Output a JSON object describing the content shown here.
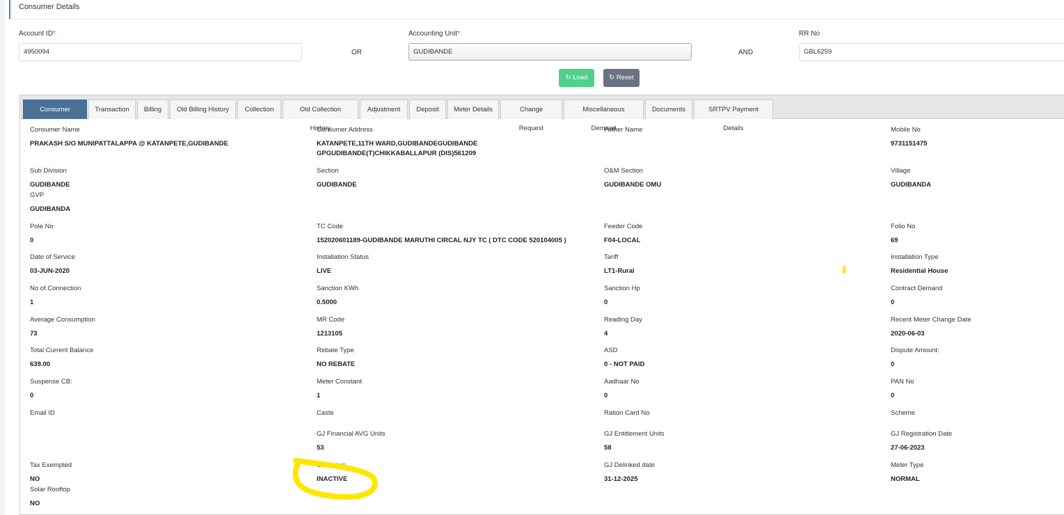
{
  "header": {
    "title": "Consumer Details"
  },
  "search": {
    "account_id_label": "Account ID",
    "account_id_value": "4950094",
    "or_label": "OR",
    "accounting_unit_label": "Accounting Unit",
    "accounting_unit_value": "GUDIBANDE",
    "and_label": "AND",
    "rr_no_label": "RR No",
    "rr_no_value": "GBL6259",
    "required_mark": "*",
    "load_label": "Load",
    "reset_label": "Reset"
  },
  "colors": {
    "load": "#4fd18b",
    "reset": "#6c7283",
    "active_tab": "#4a7094",
    "highlight": "#ffe600"
  },
  "tabs": [
    "Consumer Details",
    "Transaction",
    "Billing",
    "Old Billing History",
    "Collection",
    "Old Collection History",
    "Adjustment",
    "Deposit",
    "Meter Details",
    "Change Request",
    "Miscellaneous Demand",
    "Documents",
    "SRTPV Payment Details"
  ],
  "fields": [
    {
      "label": "Consumer Name",
      "value": "PRAKASH S/O MUNIPATTALAPPA @ KATANPETE,GUDIBANDE",
      "row": 0,
      "col": 0
    },
    {
      "label": "Consumer Address",
      "value": "KATANPETE,11TH WARD,GUDIBANDEGUDIBANDE GPGUDIBANDE(T)CHIKKABALLAPUR (DIS)561209",
      "row": 0,
      "col": 1
    },
    {
      "label": "Father Name",
      "value": "",
      "row": 0,
      "col": 2
    },
    {
      "label": "Mobile No",
      "value": "9731151475",
      "row": 0,
      "col": 3
    },
    {
      "label": "Sub Division",
      "value": "GUDIBANDE",
      "row": 1,
      "col": 0
    },
    {
      "label": "Section",
      "value": "GUDIBANDE",
      "row": 1,
      "col": 1
    },
    {
      "label": "O&M Section",
      "value": "GUDIBANDE OMU",
      "row": 1,
      "col": 2
    },
    {
      "label": "Village",
      "value": "GUDIBANDA",
      "row": 1,
      "col": 3
    },
    {
      "label": "GVP",
      "value": "GUDIBANDA",
      "row": 2,
      "col": 0
    },
    {
      "label": "Pole No",
      "value": "0",
      "row": 3,
      "col": 0
    },
    {
      "label": "TC Code",
      "value": "152020601189-GUDIBANDE MARUTHI CIRCAL NJY TC ( DTC CODE 520104005 )",
      "row": 3,
      "col": 1
    },
    {
      "label": "Feeder Code",
      "value": "F04-LOCAL",
      "row": 3,
      "col": 2
    },
    {
      "label": "Folio No",
      "value": "69",
      "row": 3,
      "col": 3
    },
    {
      "label": "Date of Service",
      "value": "03-JUN-2020",
      "row": 4,
      "col": 0
    },
    {
      "label": "Installation Status",
      "value": "LIVE",
      "row": 4,
      "col": 1
    },
    {
      "label": "Tariff",
      "value": "LT1-Rural",
      "row": 4,
      "col": 2
    },
    {
      "label": "Installation Type",
      "value": "Residential House",
      "row": 4,
      "col": 3
    },
    {
      "label": "No of Connection",
      "value": "1",
      "row": 5,
      "col": 0
    },
    {
      "label": "Sanction KWh",
      "value": "0.5000",
      "row": 5,
      "col": 1
    },
    {
      "label": "Sanction Hp",
      "value": "0",
      "row": 5,
      "col": 2
    },
    {
      "label": "Contract Demand",
      "value": "0",
      "row": 5,
      "col": 3
    },
    {
      "label": "Average Consumption",
      "value": "73",
      "row": 6,
      "col": 0
    },
    {
      "label": "MR Code",
      "value": "1213105",
      "row": 6,
      "col": 1
    },
    {
      "label": "Reading Day",
      "value": "4",
      "row": 6,
      "col": 2
    },
    {
      "label": "Recent Meter Change Date",
      "value": "2020-06-03",
      "row": 6,
      "col": 3
    },
    {
      "label": "Total Current Balance",
      "value": "639.00",
      "row": 7,
      "col": 0
    },
    {
      "label": "Rebate Type",
      "value": "NO REBATE",
      "row": 7,
      "col": 1
    },
    {
      "label": "ASD",
      "value": "0 - NOT PAID",
      "row": 7,
      "col": 2
    },
    {
      "label": "Dispute Amount:",
      "value": "0",
      "row": 7,
      "col": 3
    },
    {
      "label": "Suspense CB:",
      "value": "0",
      "row": 8,
      "col": 0
    },
    {
      "label": "Meter Constant",
      "value": "1",
      "row": 8,
      "col": 1
    },
    {
      "label": "Aadhaar No",
      "value": "0",
      "row": 8,
      "col": 2
    },
    {
      "label": "PAN No",
      "value": "0",
      "row": 8,
      "col": 3
    },
    {
      "label": "Email ID",
      "value": "",
      "row": 9,
      "col": 0
    },
    {
      "label": "Caste",
      "value": "",
      "row": 9,
      "col": 1
    },
    {
      "label": "Ration Card No",
      "value": "",
      "row": 9,
      "col": 2
    },
    {
      "label": "Scheme",
      "value": "",
      "row": 9,
      "col": 3
    },
    {
      "label": "GJ Financial AVG Units",
      "value": "53",
      "row": 10,
      "col": 1
    },
    {
      "label": "GJ Entitlement Units",
      "value": "58",
      "row": 10,
      "col": 2
    },
    {
      "label": "GJ Registration Date",
      "value": "27-06-2023",
      "row": 10,
      "col": 3
    },
    {
      "label": "Tax Exempted",
      "value": "NO",
      "row": 11,
      "col": 0
    },
    {
      "label": "GJ Status",
      "value": "INACTIVE",
      "row": 11,
      "col": 1
    },
    {
      "label": "GJ Delinked date",
      "value": "31-12-2025",
      "row": 11,
      "col": 2
    },
    {
      "label": "Meter Type",
      "value": "NORMAL",
      "row": 11,
      "col": 3
    },
    {
      "label": "Solar Rooftop",
      "value": "NO",
      "row": 12,
      "col": 0
    }
  ]
}
